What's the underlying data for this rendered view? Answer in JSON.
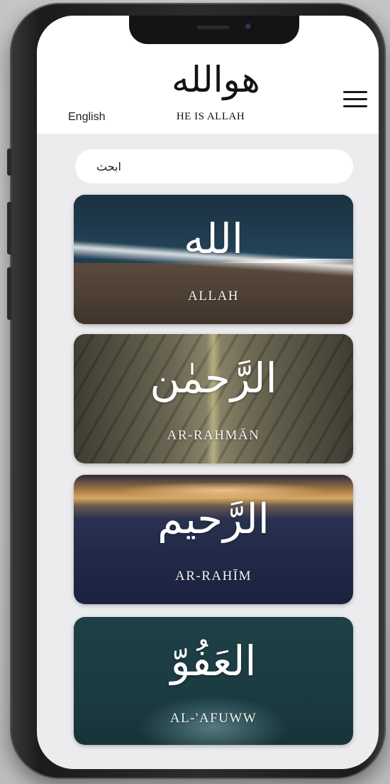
{
  "header": {
    "logo_arabic": "هوالله",
    "logo_subtitle": "HE IS ALLAH",
    "language": "English"
  },
  "search": {
    "placeholder": "ابحث"
  },
  "names": [
    {
      "arabic": "الله",
      "latin": "ALLAH"
    },
    {
      "arabic": "الرَّحمٰن",
      "latin": "AR-RAHMĀN"
    },
    {
      "arabic": "الرَّحيم",
      "latin": "AR-RAHĪM"
    },
    {
      "arabic": "العَفُوّ",
      "latin": "AL-'AFUWW"
    }
  ],
  "icons": {
    "menu": "hamburger-menu-icon",
    "camera": "front-camera-icon"
  },
  "colors": {
    "screen_bg": "#ececee",
    "header_bg": "#ffffff",
    "text": "#111111"
  }
}
